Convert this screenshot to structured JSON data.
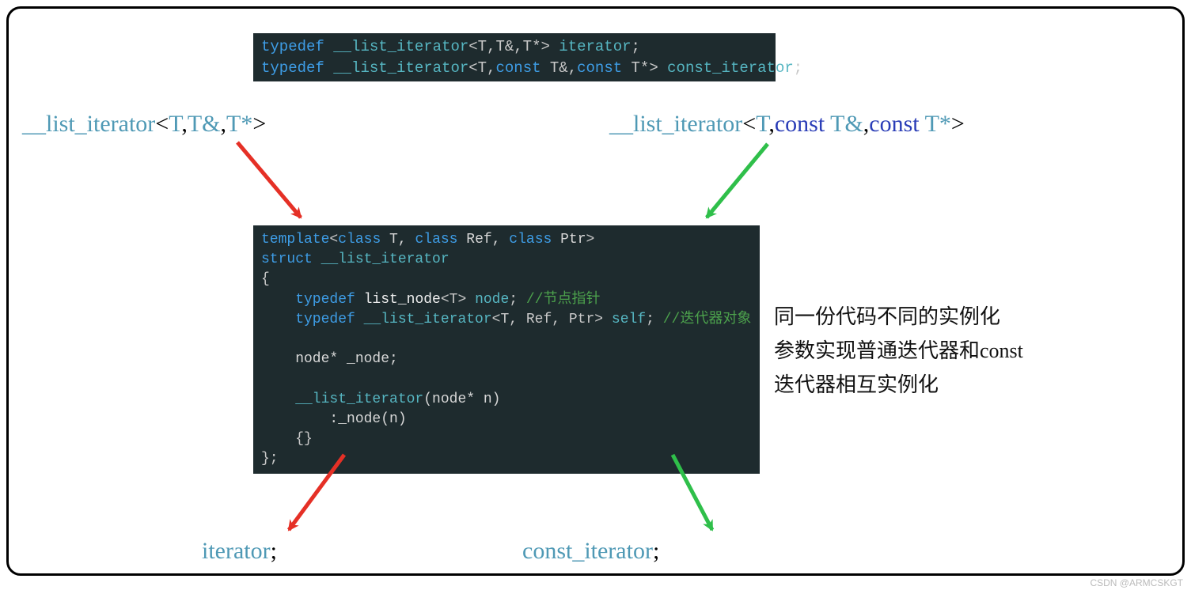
{
  "code_top": {
    "line1": {
      "kw": "typedef",
      "name": "__list_iterator",
      "tparams": "<T,T&,T*>",
      "alias": "iterator",
      "end": ";"
    },
    "line2": {
      "kw": "typedef",
      "name": "__list_iterator",
      "tparams1": "<T,",
      "const1": "const",
      "mid1": " T&,",
      "const2": "const",
      "mid2": " T*>",
      "alias": "const_iterator",
      "end": ";"
    }
  },
  "label_left": {
    "name": "__list_iterator",
    "open": "<",
    "t": "T",
    "sep1": ",",
    "tref": "T&",
    "sep2": ",",
    "tptr": "T*",
    "close": ">"
  },
  "label_right": {
    "name": "__list_iterator",
    "open": "<",
    "t": "T",
    "sep1": ",",
    "const1": "const",
    "sp1": " ",
    "tref": "T&",
    "sep2": ",",
    "const2": "const",
    "sp2": " ",
    "tptr": "T*",
    "close": ">"
  },
  "code_mid": {
    "l1a": "template",
    "l1b": "<",
    "l1c": "class",
    "l1d": " T, ",
    "l1e": "class",
    "l1f": " Ref, ",
    "l1g": "class",
    "l1h": " Ptr",
    "l1i": ">",
    "l2a": "struct",
    "l2b": " __list_iterator",
    "l3": "{",
    "l4a": "    typedef",
    "l4b": " list_node",
    "l4c": "<T>",
    "l4d": " node",
    "l4e": ";",
    "l4f": " //节点指针",
    "l5a": "    typedef",
    "l5b": " __list_iterator",
    "l5c": "<T, Ref, Ptr>",
    "l5d": " self",
    "l5e": ";",
    "l5f": " //迭代器对象",
    "l6": "",
    "l7": "    node* _node;",
    "l8": "",
    "l9a": "    __list_iterator",
    "l9b": "(node* n)",
    "l10": "        :_node(n)",
    "l11": "    {}",
    "l12": "};"
  },
  "side_note": {
    "line1": "同一份代码不同的实例化",
    "line2": "参数实现普通迭代器和const",
    "line3": "迭代器相互实例化"
  },
  "bottom_left": {
    "name": "iterator",
    "end": ";"
  },
  "bottom_right": {
    "name": "const_iterator",
    "end": ";"
  },
  "watermark": "CSDN @ARMCSKGT"
}
